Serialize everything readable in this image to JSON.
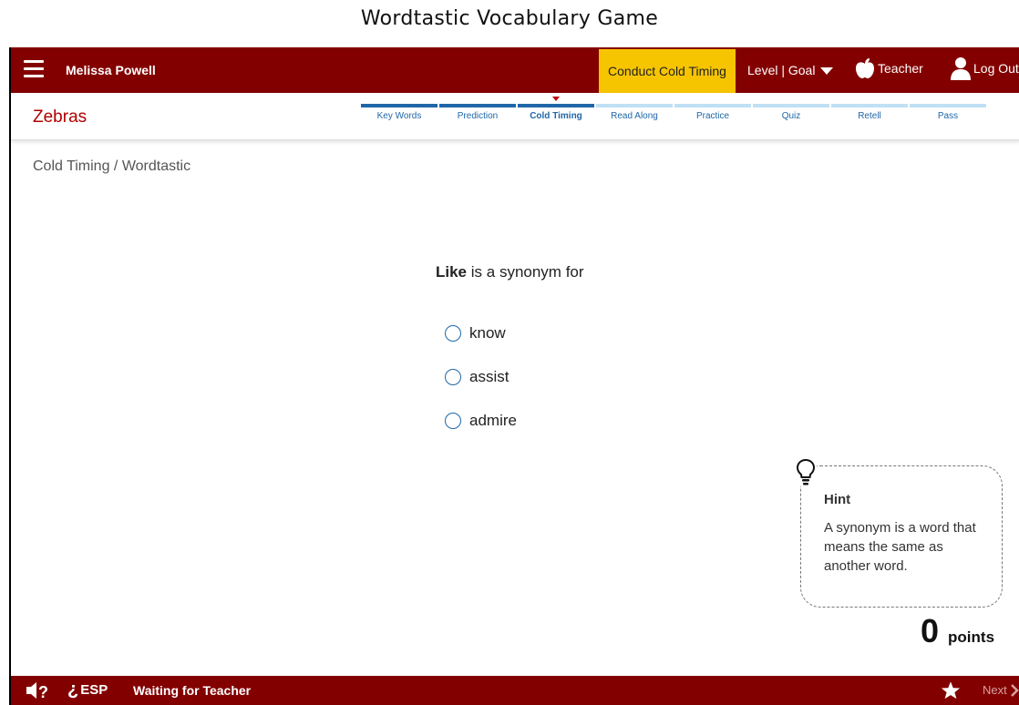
{
  "page_title": "Wordtastic Vocabulary Game",
  "topbar": {
    "user_name": "Melissa Powell",
    "conduct_button": "Conduct Cold Timing",
    "level_goal": "Level | Goal",
    "teacher": "Teacher",
    "logout": "Log Out"
  },
  "subheader": {
    "story_title": "Zebras",
    "steps": [
      {
        "label": "Key Words",
        "state": "done"
      },
      {
        "label": "Prediction",
        "state": "done"
      },
      {
        "label": "Cold Timing",
        "state": "current"
      },
      {
        "label": "Read Along",
        "state": "todo"
      },
      {
        "label": "Practice",
        "state": "todo"
      },
      {
        "label": "Quiz",
        "state": "todo"
      },
      {
        "label": "Retell",
        "state": "todo"
      },
      {
        "label": "Pass",
        "state": "todo"
      }
    ]
  },
  "breadcrumb": "Cold Timing / Wordtastic",
  "question": {
    "word": "Like",
    "prompt": "is a synonym for",
    "options": [
      "know",
      "assist",
      "admire"
    ]
  },
  "hint": {
    "title": "Hint",
    "text": "A synonym is a word that means the same as another word."
  },
  "score": {
    "value": "0",
    "unit": "points"
  },
  "bottombar": {
    "esp_label": "ESP",
    "status": "Waiting for Teacher",
    "next_label": "Next"
  },
  "colors": {
    "brand": "#830000",
    "accent": "#f7c500",
    "progress_done": "#1f66a8",
    "progress_todo": "#bfe0f5"
  }
}
